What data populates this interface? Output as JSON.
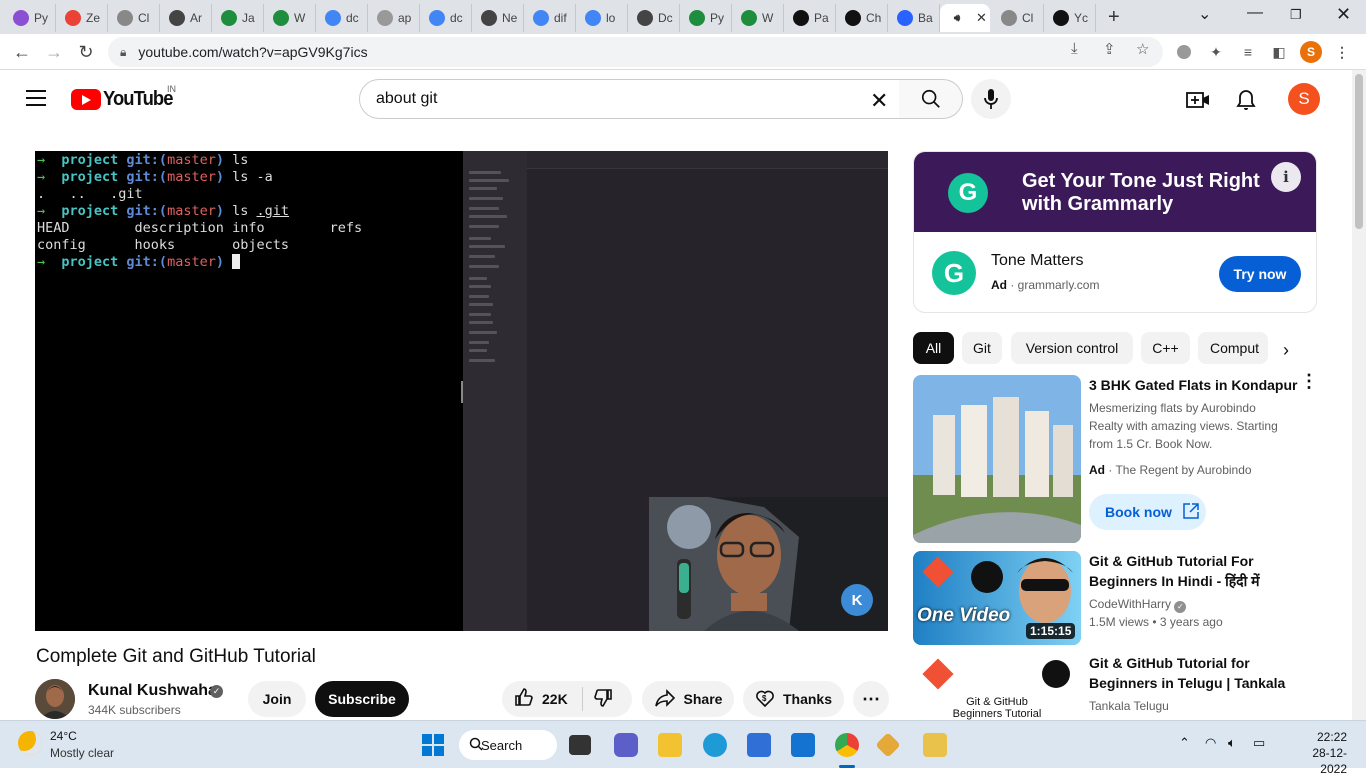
{
  "browser": {
    "tabs": [
      {
        "label": "Py",
        "fav": "#8a4fd3"
      },
      {
        "label": "Ze",
        "fav": "#ea4335"
      },
      {
        "label": "Cl",
        "fav": "#888888"
      },
      {
        "label": "Ar",
        "fav": "#444444"
      },
      {
        "label": "Ja",
        "fav": "#1e8e3e"
      },
      {
        "label": "W",
        "fav": "#1e8e3e"
      },
      {
        "label": "dc",
        "fav": "#4285f4"
      },
      {
        "label": "ap",
        "fav": "#999999"
      },
      {
        "label": "dc",
        "fav": "#4285f4"
      },
      {
        "label": "Ne",
        "fav": "#444444"
      },
      {
        "label": "dif",
        "fav": "#4285f4"
      },
      {
        "label": "lo",
        "fav": "#4285f4"
      },
      {
        "label": "Dc",
        "fav": "#444444"
      },
      {
        "label": "Py",
        "fav": "#1e8e3e"
      },
      {
        "label": "W",
        "fav": "#1e8e3e"
      },
      {
        "label": "Pa",
        "fav": "#111111"
      },
      {
        "label": "Ch",
        "fav": "#111111"
      },
      {
        "label": "Ba",
        "fav": "#2962ff"
      },
      {
        "label": "",
        "fav": "#555555",
        "active": true
      },
      {
        "label": "Cl",
        "fav": "#888888"
      },
      {
        "label": "Yc",
        "fav": "#111111"
      }
    ],
    "url": "youtube.com/watch?v=apGV9Kg7ics",
    "profile_initial": "S"
  },
  "youtube": {
    "logo_text": "YouTube",
    "country_code": "IN",
    "search_query": "about git",
    "avatar_initial": "S",
    "terminal": [
      {
        "segs": [
          [
            "arrow",
            "→  "
          ],
          [
            "dir",
            "project "
          ],
          [
            "git",
            "git:("
          ],
          [
            "br",
            "master"
          ],
          [
            "git",
            ") "
          ],
          [
            "plain",
            "ls"
          ]
        ]
      },
      {
        "segs": [
          [
            "arrow",
            "→  "
          ],
          [
            "dir",
            "project "
          ],
          [
            "git",
            "git:("
          ],
          [
            "br",
            "master"
          ],
          [
            "git",
            ") "
          ],
          [
            "plain",
            "ls -a"
          ]
        ]
      },
      {
        "segs": [
          [
            "plain",
            ".   ..   .git"
          ]
        ]
      },
      {
        "segs": [
          [
            "arrow",
            "→  "
          ],
          [
            "dir",
            "project "
          ],
          [
            "git",
            "git:("
          ],
          [
            "br",
            "master"
          ],
          [
            "git",
            ") "
          ],
          [
            "plain",
            "ls "
          ],
          [
            "u",
            ".git"
          ]
        ]
      },
      {
        "segs": [
          [
            "plain",
            "HEAD        description info        refs"
          ]
        ]
      },
      {
        "segs": [
          [
            "plain",
            "config      hooks       objects"
          ]
        ]
      },
      {
        "segs": [
          [
            "arrow",
            "→  "
          ],
          [
            "dir",
            "project "
          ],
          [
            "git",
            "git:("
          ],
          [
            "br",
            "master"
          ],
          [
            "git",
            ") "
          ],
          [
            "cursor",
            ""
          ]
        ]
      }
    ],
    "video": {
      "title": "Complete Git and GitHub Tutorial",
      "channel": "Kunal Kushwaha",
      "subscribers": "344K subscribers",
      "join_label": "Join",
      "subscribe_label": "Subscribe",
      "likes": "22K",
      "share_label": "Share",
      "thanks_label": "Thanks"
    },
    "ad": {
      "banner_text": "Get Your Tone Just Right with Grammarly",
      "name": "Tone Matters",
      "ad_badge": "Ad",
      "domain": "grammarly.com",
      "cta": "Try now"
    },
    "chips": [
      "All",
      "Git",
      "Version control",
      "C++",
      "Comput"
    ],
    "recommendations": [
      {
        "title": "3 BHK Gated Flats in Kondapur",
        "desc": "Mesmerizing flats by Aurobindo Realty with amazing views. Starting from 1.5 Cr. Book Now.",
        "ad_badge": "Ad",
        "advertiser": "The Regent by Aurobindo",
        "cta": "Book now"
      },
      {
        "title": "Git & GitHub Tutorial For Beginners In Hindi - हिंदी में",
        "channel": "CodeWithHarry",
        "views": "1.5M views",
        "age": "3 years ago",
        "duration": "1:15:15",
        "thumb_text": "One Video"
      },
      {
        "title": "Git & GitHub Tutorial for Beginners in Telugu | Tankala",
        "channel": "Tankala Telugu",
        "thumb_text": "Git & GitHub Beginners Tutorial"
      }
    ]
  },
  "taskbar": {
    "temperature": "24°C",
    "weather": "Mostly clear",
    "search_label": "Search",
    "time": "22:22",
    "date": "28-12-2022"
  }
}
